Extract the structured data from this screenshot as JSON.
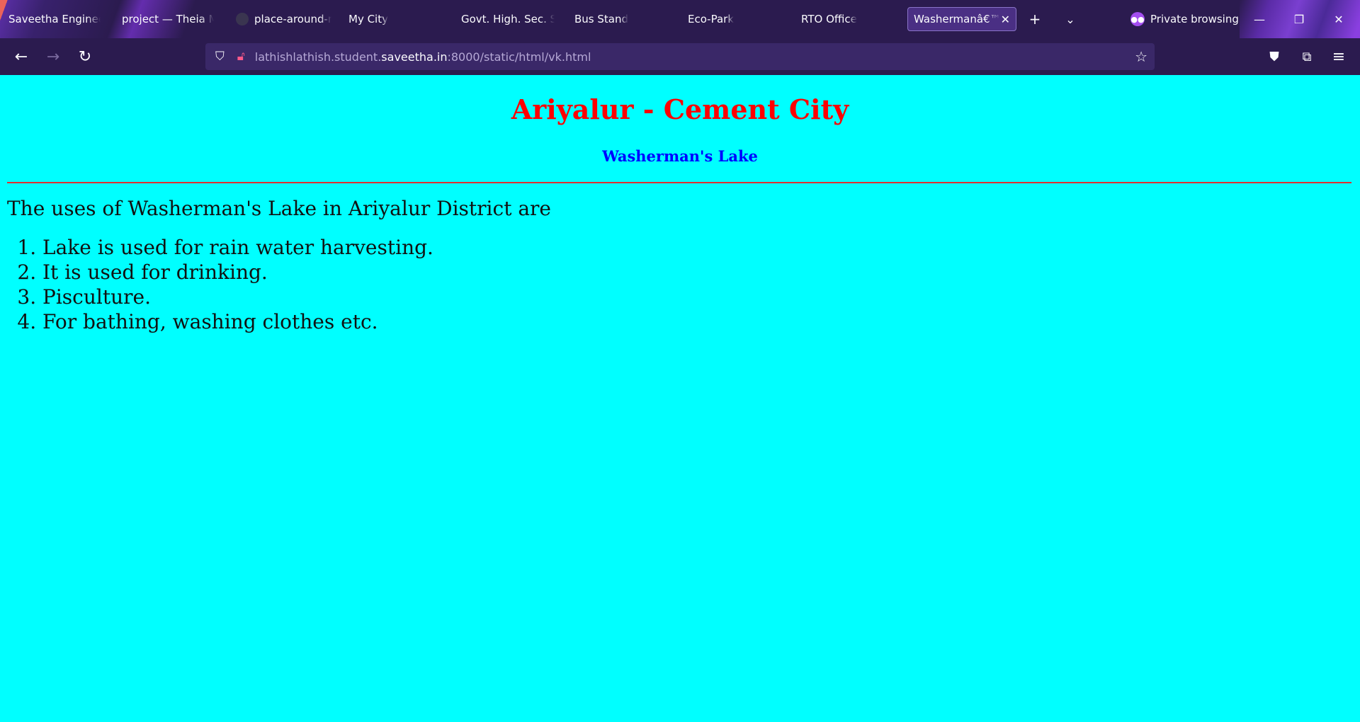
{
  "browser": {
    "tabs": [
      {
        "label": "Saveetha Engineering College",
        "active": false
      },
      {
        "label": "project — Theia Multi",
        "active": false
      },
      {
        "label": "place-around-my-city",
        "active": false,
        "icon": "github-icon"
      },
      {
        "label": "My City",
        "active": false
      },
      {
        "label": "Govt. High. Sec. School",
        "active": false
      },
      {
        "label": "Bus Stand",
        "active": false
      },
      {
        "label": "Eco-Park",
        "active": false
      },
      {
        "label": "RTO Office",
        "active": false
      },
      {
        "label": "Washermanâ€™s",
        "active": true
      }
    ],
    "private_label": "Private browsing",
    "url": {
      "prefix": "lathishlathish.student.",
      "domain": "saveetha.in",
      "suffix": ":8000/static/html/vk.html"
    }
  },
  "page": {
    "title": "Ariyalur - Cement City",
    "subtitle": "Washerman's Lake",
    "intro": "The uses of Washerman's Lake in Ariyalur District are",
    "uses": [
      "Lake is used for rain water harvesting.",
      "It is used for drinking.",
      "Pisculture.",
      "For bathing, washing clothes etc."
    ]
  },
  "colors": {
    "page_background": "#00ffff",
    "title": "#ff0000",
    "subtitle": "#0000ff",
    "rule": "#e03030",
    "chrome": "#2b1b4f"
  }
}
